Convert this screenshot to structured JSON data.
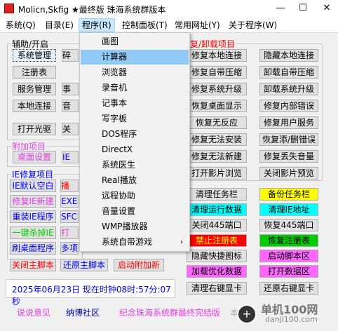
{
  "window": {
    "title": "Molicn,Skfig ★最终版 珠海系统群版本",
    "min": "—",
    "max": "☐",
    "close": "✕"
  },
  "menubar": [
    "系统(Q)",
    "目录(E)",
    "程序(R)",
    "控制面板(T)",
    "常用网址(Y)",
    "关于程序(W)"
  ],
  "left_panel": {
    "group1_label": "辅助/开启",
    "group1_buttons": [
      "系统管理",
      "注册表",
      "服务管理",
      "本地连接",
      "打开光驱"
    ],
    "partial_col": [
      "碎",
      "事",
      "音",
      "关"
    ],
    "group2_label": "附加项目",
    "group2_buttons": [
      "桌面设置",
      "IE"
    ],
    "group3_label": "IE修复项目",
    "group3_rows": [
      [
        "IE默认空白",
        "播"
      ],
      [
        "修复IE新建",
        "EXE"
      ],
      [
        "重装IE程序",
        "SFC"
      ],
      [
        "一键杀掉IE",
        "打"
      ],
      [
        "刷桌面程序",
        "多项"
      ]
    ],
    "bottom_buttons": [
      "关闭主脚本",
      "还原主脚本",
      "启动附加新"
    ]
  },
  "dropdown": {
    "items": [
      "画图",
      "计算器",
      "浏览器",
      "录音机",
      "记事本",
      "写字板",
      "DOS程序",
      "DirectX",
      "系统医生",
      "Real播放",
      "远程协助",
      "音量设置",
      "WMP播放器",
      "系统自带游戏"
    ],
    "submenu_arrow": "›"
  },
  "right_panel": {
    "group_label": "复/卸载项目",
    "rows": [
      [
        "修复本地连接",
        "隐藏本地连接"
      ],
      [
        "修复自带压缩",
        "卸载自带压缩"
      ],
      [
        "修复系统升级",
        "卸载系统升级"
      ],
      [
        "恢复桌面显示",
        "修复内部错误"
      ],
      [
        "恢复无反应",
        "修复用户服务"
      ],
      [
        "修复无法安装",
        "恢复添/删错误"
      ],
      [
        "修复无法新建",
        "修复丢失音量"
      ],
      [
        "打开影片浏览",
        "关闭影片预览"
      ]
    ],
    "rows2": [
      [
        "清理任务栏",
        "备份任务栏"
      ],
      [
        "清理运行数据",
        "清理IE地址"
      ],
      [
        "关闭445端口",
        "恢复445端口"
      ],
      [
        "禁止注册表",
        "恢复注册表"
      ],
      [
        "隐藏快捷图标",
        "启动脚本区"
      ],
      [
        "加载优化数据",
        "打开数据区"
      ],
      [
        "清理右键显卡",
        "还原右键显卡"
      ]
    ]
  },
  "status": "2025年06月23日 现在时钟08时:57分:07秒",
  "footer": [
    "说说意见",
    "纳博社区",
    "纪念珠海系统群最终完结版",
    "本"
  ],
  "watermark": {
    "glyph": "+",
    "text": "单机100网",
    "sub": "danji100.com"
  },
  "colors": {
    "accent_blue": "#0000ff",
    "red_text": "#ff0000",
    "pink_text": "#e040e0",
    "highlight_yellow": "#ffff00",
    "highlight_cyan": "#00ffff",
    "highlight_red": "#ff0000",
    "highlight_green": "#00cc00",
    "highlight_pink": "#ff66ff",
    "menu_hover": "#91c9f7"
  }
}
